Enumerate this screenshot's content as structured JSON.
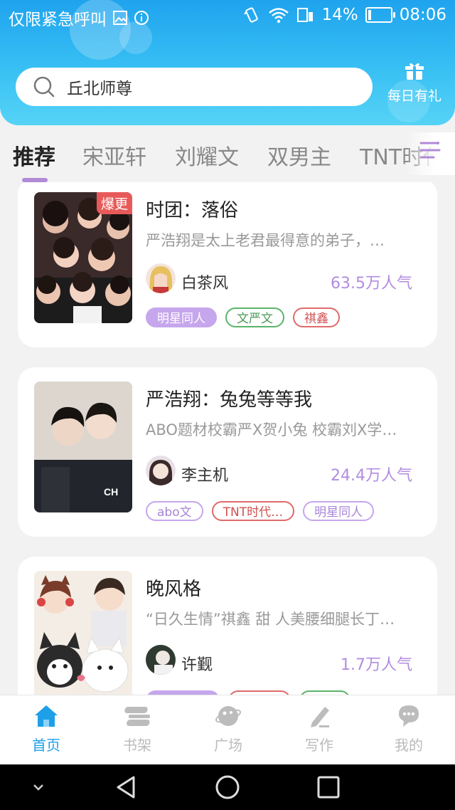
{
  "status_bar": {
    "notification": "仅限紧急呼叫",
    "battery": "14%",
    "battery_level": 0.14,
    "time": "08:06"
  },
  "search": {
    "text": "丘北师尊"
  },
  "gift": {
    "label": "每日有礼"
  },
  "tabs": [
    {
      "label": "推荐",
      "active": true
    },
    {
      "label": "宋亚轩",
      "active": false
    },
    {
      "label": "刘耀文",
      "active": false
    },
    {
      "label": "双男主",
      "active": false
    },
    {
      "label": "TNT时代少",
      "active": false
    }
  ],
  "books": [
    {
      "title": "时团：落俗",
      "badge": "爆更",
      "desc": "严浩翔是太上老君最得意的弟子，…",
      "author": "白茶风",
      "popularity": "63.5万人气",
      "tags": [
        {
          "label": "明星同人",
          "style": "purple-fill"
        },
        {
          "label": "文严文",
          "style": "green"
        },
        {
          "label": "祺鑫",
          "style": "red"
        }
      ]
    },
    {
      "title": "严浩翔：兔兔等等我",
      "desc": "ABO题材校霸严X贺小兔 校霸刘X学…",
      "author": "李主机",
      "popularity": "24.4万人气",
      "tags": [
        {
          "label": "abo文",
          "style": "purple"
        },
        {
          "label": "TNT时代…",
          "style": "red"
        },
        {
          "label": "明星同人",
          "style": "purple"
        }
      ]
    },
    {
      "title": "晚风格",
      "desc": "“日久生情”祺鑫 甜 人美腰细腿长丁…",
      "author": "许觐",
      "popularity": "1.7万人气",
      "tags": [
        {
          "label": "",
          "style": "purple-fill"
        },
        {
          "label": "",
          "style": "red"
        },
        {
          "label": "",
          "style": "green"
        }
      ]
    }
  ],
  "bottom_nav": [
    {
      "label": "首页",
      "icon": "home-icon",
      "active": true
    },
    {
      "label": "书架",
      "icon": "bookshelf-icon",
      "active": false
    },
    {
      "label": "广场",
      "icon": "plaza-icon",
      "active": false
    },
    {
      "label": "写作",
      "icon": "pen-icon",
      "active": false
    },
    {
      "label": "我的",
      "icon": "profile-icon",
      "active": false
    }
  ],
  "colors": {
    "accent": "#1e9fe8",
    "header_top": "#1fa3ee",
    "header_bottom": "#55d3f6",
    "popularity": "#b28de0",
    "tab_indicator": "#b18ad8",
    "badge": "#e85a5a"
  }
}
